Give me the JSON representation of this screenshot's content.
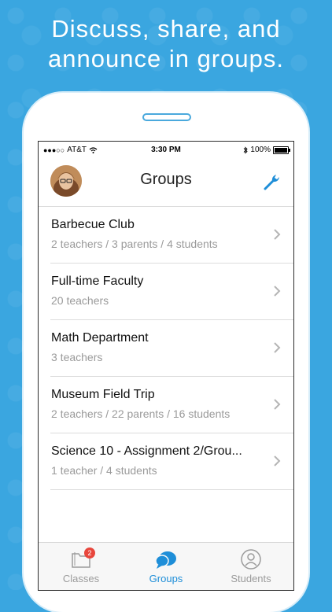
{
  "headline": {
    "line1": "Discuss, share, and",
    "line2": "announce in groups."
  },
  "status_bar": {
    "carrier": "AT&T",
    "time": "3:30 PM",
    "battery": "100%",
    "battery_level": 1.0
  },
  "nav": {
    "title": "Groups"
  },
  "groups": [
    {
      "name": "Barbecue Club",
      "members": "2 teachers / 3 parents / 4 students"
    },
    {
      "name": "Full-time Faculty",
      "members": "20 teachers"
    },
    {
      "name": "Math Department",
      "members": "3 teachers"
    },
    {
      "name": "Museum Field Trip",
      "members": "2 teachers / 22 parents / 16 students"
    },
    {
      "name": "Science 10 - Assignment 2/Grou...",
      "members": "1 teacher / 4 students"
    }
  ],
  "tabs": [
    {
      "label": "Classes",
      "badge": "2",
      "icon": "folder-icon"
    },
    {
      "label": "Groups",
      "icon": "chat-bubble-icon",
      "active": true
    },
    {
      "label": "Students",
      "icon": "person-icon"
    }
  ],
  "colors": {
    "accent": "#1e8ed8",
    "background": "#3aa6e0",
    "badge": "#e8463c"
  }
}
